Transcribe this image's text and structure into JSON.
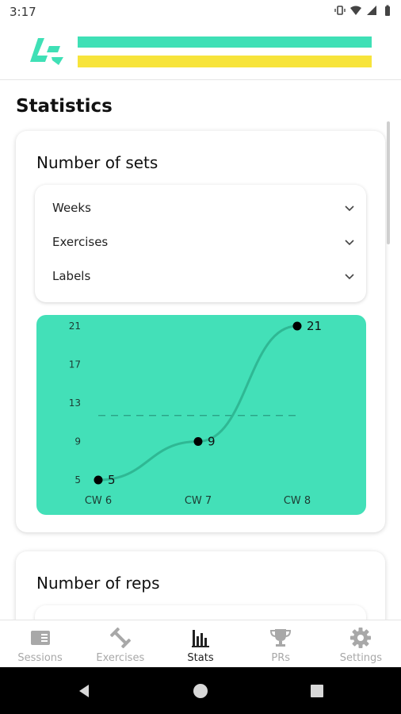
{
  "status_bar": {
    "time": "3:17"
  },
  "brand": {
    "primary_color": "#3fe0b6",
    "secondary_color": "#f7e43b"
  },
  "page": {
    "title": "Statistics"
  },
  "sets_card": {
    "title": "Number of sets",
    "filters": [
      "Weeks",
      "Exercises",
      "Labels"
    ]
  },
  "reps_card": {
    "title": "Number of reps"
  },
  "chart_data": {
    "type": "line",
    "categories": [
      "CW 6",
      "CW 7",
      "CW 8"
    ],
    "values": [
      5,
      9,
      21
    ],
    "data_labels": [
      "5",
      "9",
      "21"
    ],
    "ylim": [
      5,
      21
    ],
    "yticks": [
      "21",
      "17",
      "13",
      "9",
      "5"
    ],
    "average_line": 11.7,
    "background_color": "#43e0b8",
    "line_color": "#2fb894"
  },
  "bottom_nav": {
    "items": [
      {
        "label": "Sessions",
        "icon": "sessions-icon",
        "active": false
      },
      {
        "label": "Exercises",
        "icon": "dumbbell-icon",
        "active": false
      },
      {
        "label": "Stats",
        "icon": "stats-icon",
        "active": true
      },
      {
        "label": "PRs",
        "icon": "trophy-icon",
        "active": false
      },
      {
        "label": "Settings",
        "icon": "gear-icon",
        "active": false
      }
    ]
  }
}
